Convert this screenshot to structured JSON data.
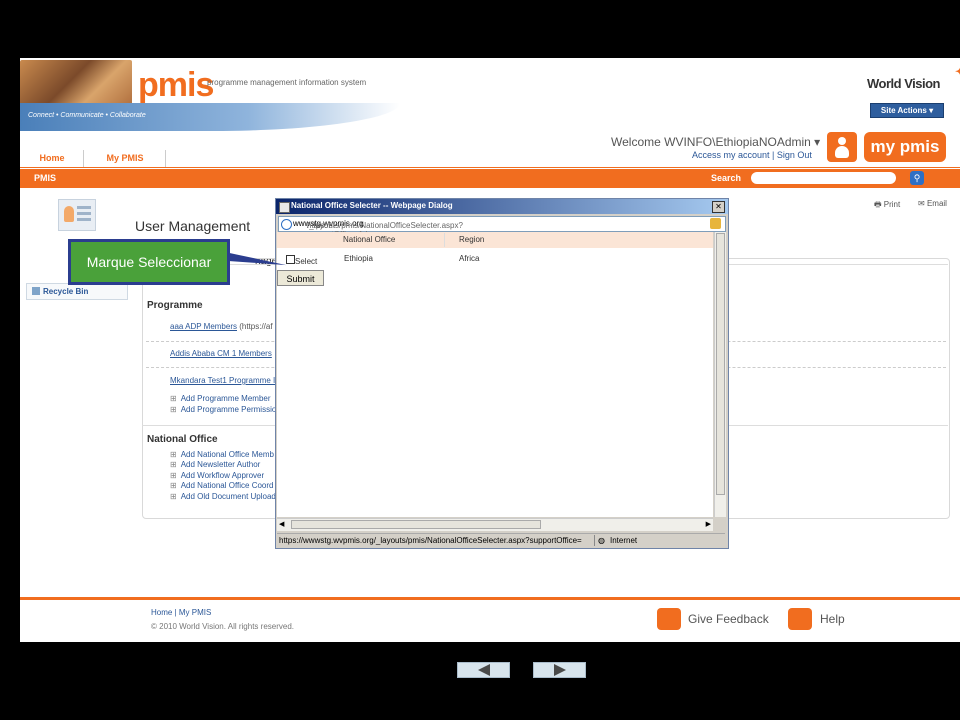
{
  "header": {
    "tagline": "Connect • Communicate • Collaborate",
    "logo": "pmis",
    "logo_sub": "programme management information system",
    "org_logo": "World Vision",
    "site_actions": "Site Actions ▾",
    "welcome": "Welcome WVINFO\\EthiopiaNOAdmin ▾",
    "access_links": "Access my account | Sign Out",
    "mypmis_logo": "my pmis",
    "tabs": [
      {
        "label": "Home"
      },
      {
        "label": "My PMIS"
      }
    ]
  },
  "bar": {
    "label": "PMIS",
    "search_label": "Search",
    "search_value": ""
  },
  "tools": {
    "print": "Print",
    "email": "Email"
  },
  "page_title": "User Management",
  "page_title_hidden": "nage",
  "left_nav": {
    "recycle_bin": "Recycle Bin"
  },
  "programme": {
    "title": "Programme",
    "links": [
      {
        "label": "aaa ADP Members",
        "suffix": " (https://af"
      },
      {
        "label": "Addis Ababa CM 1 Members"
      },
      {
        "label": "Mkandara Test1 Programme I"
      }
    ],
    "actions": [
      "Add Programme Member",
      "Add Programme Permissio"
    ]
  },
  "national_office": {
    "title": "National Office",
    "actions": [
      "Add National Office Memb",
      "Add Newsletter Author",
      "Add Workflow Approver",
      "Add National Office Coord",
      "Add Old Document Upload"
    ]
  },
  "footer": {
    "links": "Home | My PMIS",
    "copyright": "© 2010 World Vision. All rights reserved.",
    "give_feedback": "Give Feedback",
    "help": "Help"
  },
  "dialog": {
    "title": "National Office Selecter -- Webpage Dialog",
    "url_prefix": "https://",
    "url_host": "wwwstg.wvpmis.org",
    "url_path": "/_layouts/pmis/NationalOfficeSelecter.aspx?supportOffice=false",
    "columns": [
      "National Office",
      "Region"
    ],
    "rows": [
      {
        "select_label": "Select",
        "office": "Ethiopia",
        "region": "Africa"
      }
    ],
    "submit": "Submit",
    "status_url": "https://wwwstg.wvpmis.org/_layouts/pmis/NationalOfficeSelecter.aspx?supportOffice=",
    "status_zone": "Internet"
  },
  "callout": {
    "text": "Marque Seleccionar"
  },
  "colors": {
    "accent": "#f16d1f",
    "callout_bg": "#4aa13a",
    "callout_border": "#2b3d8f"
  }
}
